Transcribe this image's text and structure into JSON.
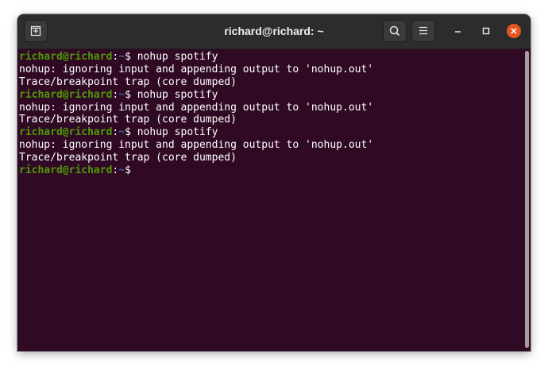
{
  "window": {
    "title": "richard@richard: ~"
  },
  "titlebar": {
    "new_tab_icon": "new-tab-icon",
    "search_icon": "search-icon",
    "menu_icon": "hamburger-menu-icon",
    "minimize_icon": "minimize-icon",
    "maximize_icon": "maximize-icon",
    "close_icon": "close-icon",
    "close_color": "#e95420"
  },
  "terminal": {
    "colors": {
      "background": "#300a24",
      "prompt_user": "#4e9a06",
      "prompt_path": "#3465a4",
      "text": "#ffffff"
    },
    "lines": [
      {
        "type": "prompt",
        "user": "richard@richard",
        "sep": ":",
        "path": "~",
        "symbol": "$ ",
        "command": "nohup spotify"
      },
      {
        "type": "output",
        "text": "nohup: ignoring input and appending output to 'nohup.out'"
      },
      {
        "type": "output",
        "text": "Trace/breakpoint trap (core dumped)"
      },
      {
        "type": "prompt",
        "user": "richard@richard",
        "sep": ":",
        "path": "~",
        "symbol": "$ ",
        "command": "nohup spotify"
      },
      {
        "type": "output",
        "text": "nohup: ignoring input and appending output to 'nohup.out'"
      },
      {
        "type": "output",
        "text": "Trace/breakpoint trap (core dumped)"
      },
      {
        "type": "prompt",
        "user": "richard@richard",
        "sep": ":",
        "path": "~",
        "symbol": "$ ",
        "command": "nohup spotify"
      },
      {
        "type": "output",
        "text": "nohup: ignoring input and appending output to 'nohup.out'"
      },
      {
        "type": "output",
        "text": "Trace/breakpoint trap (core dumped)"
      },
      {
        "type": "prompt",
        "user": "richard@richard",
        "sep": ":",
        "path": "~",
        "symbol": "$",
        "command": ""
      }
    ]
  }
}
